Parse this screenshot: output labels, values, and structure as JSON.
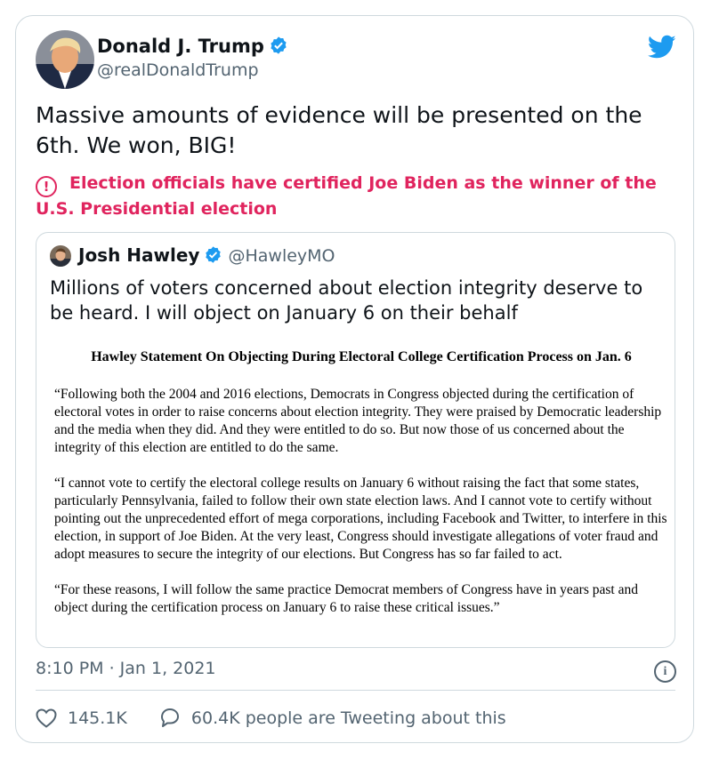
{
  "author": {
    "name": "Donald J. Trump",
    "handle": "@realDonaldTrump",
    "avatar_icon": "profile-photo",
    "verified_icon": "verified-badge-icon"
  },
  "tweet": {
    "text": "Massive amounts of evidence will be presented on the 6th. We won, BIG!",
    "notice": "Election officials have certified Joe Biden as the winner of the U.S. Presidential election",
    "notice_icon": "!",
    "timestamp": "8:10 PM · Jan 1, 2021"
  },
  "quoted": {
    "name": "Josh Hawley",
    "handle": "@HawleyMO",
    "text": "Millions of voters concerned about election integrity deserve to be heard. I will object on January 6 on their behalf",
    "statement": {
      "title": "Hawley Statement On Objecting During Electoral College Certification Process on Jan. 6",
      "paragraphs": [
        "“Following both the 2004 and 2016 elections, Democrats in Congress objected during the certification of electoral votes in order to raise concerns about election integrity. They were praised by Democratic leadership and the media when they did. And they were entitled to do so. But now those of us concerned about the integrity of this election are entitled to do the same.",
        "“I cannot vote to certify the electoral college results on January 6 without raising the fact that some states, particularly Pennsylvania, failed to follow their own state election laws. And I cannot vote to certify without pointing out the unprecedented effort of mega corporations, including Facebook and Twitter, to interfere in this election, in support of Joe Biden. At the very least, Congress should investigate allegations of voter fraud and adopt measures to secure the integrity of our elections. But Congress has so far failed to act.",
        "“For these reasons, I will follow the same practice Democrat members of Congress have in years past and object during the certification process on January 6 to raise these critical issues.”"
      ]
    }
  },
  "actions": {
    "likes": "145.1K",
    "replies": "60.4K people are Tweeting about this"
  },
  "colors": {
    "twitter_blue": "#1d9bf0",
    "notice_red": "#e0245e",
    "secondary_text": "#536471",
    "border": "#cfd9de"
  }
}
